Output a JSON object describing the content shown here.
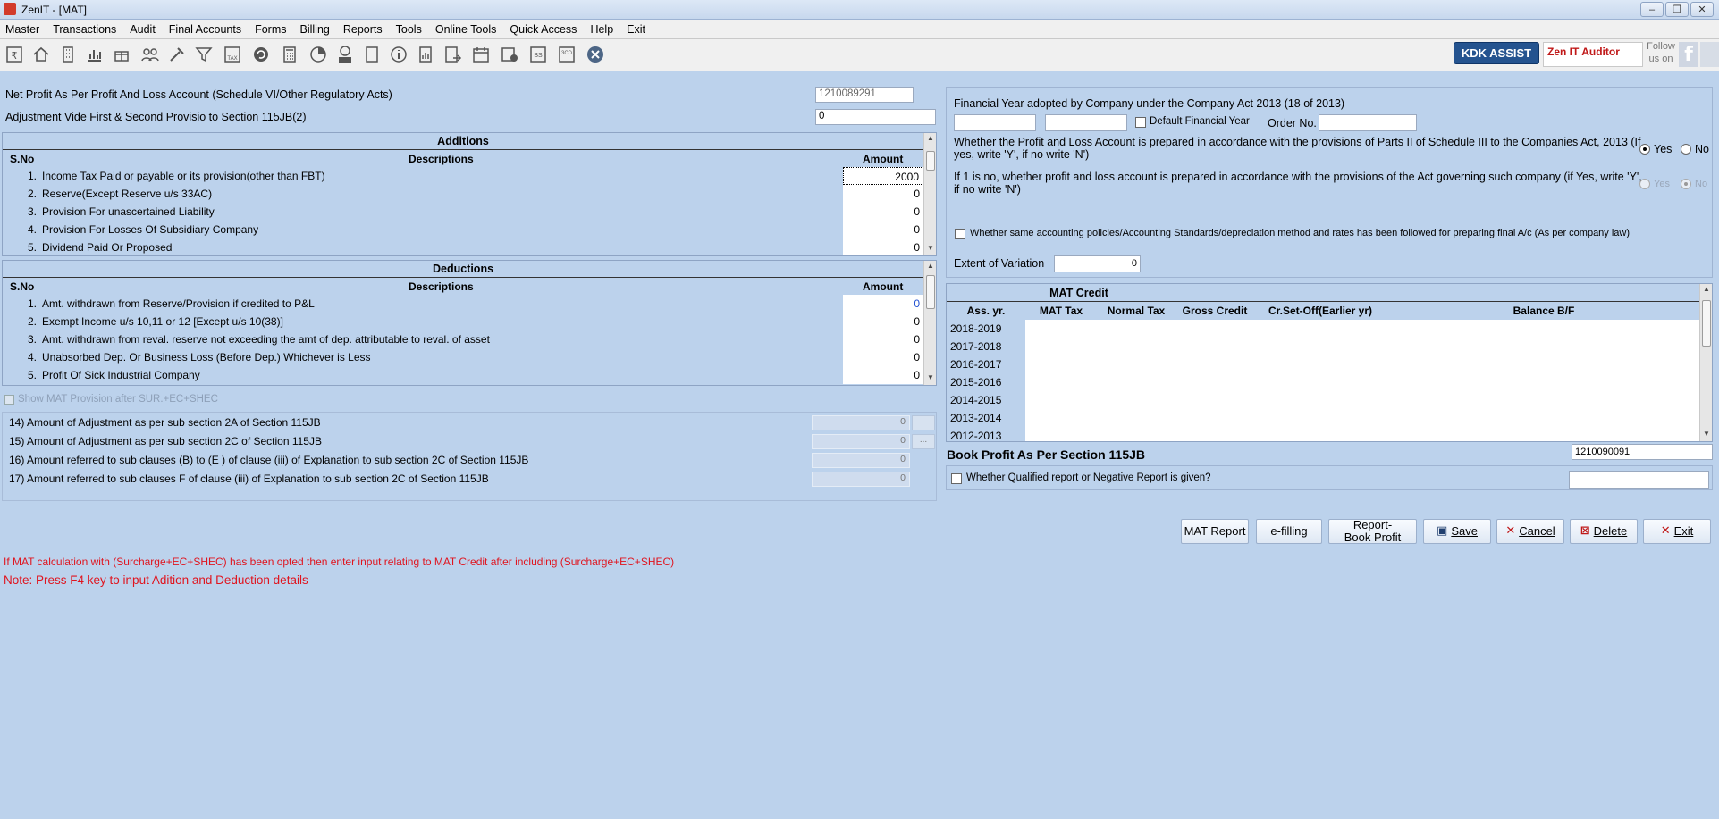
{
  "window": {
    "title": "ZenIT - [MAT]"
  },
  "menu": [
    "Master",
    "Transactions",
    "Audit",
    "Final Accounts",
    "Forms",
    "Billing",
    "Reports",
    "Tools",
    "Online Tools",
    "Quick Access",
    "Help",
    "Exit"
  ],
  "toolbar": {
    "icons": [
      "rupee-icon",
      "home-icon",
      "building-icon",
      "chart-icon",
      "gift-icon",
      "users-icon",
      "tools-icon",
      "filter-icon",
      "tax-icon",
      "refresh-icon",
      "calculator-icon",
      "pie-icon",
      "pay-icon",
      "book-icon",
      "info-icon",
      "document-icon",
      "export-icon",
      "calendar-icon",
      "settings-icon",
      "bs-icon",
      "3cd-icon",
      "close-icon"
    ],
    "kdk_assist": "KDK ASSIST",
    "zen_auditor": "Zen IT Auditor",
    "follow_us": "Follow us on"
  },
  "left": {
    "net_profit_label": "Net Profit As Per Profit And Loss Account (Schedule VI/Other Regulatory Acts)",
    "net_profit_value": "1210089291",
    "adjustment_label": "Adjustment Vide First & Second Provisio to Section 115JB(2)",
    "adjustment_value": "0",
    "additions": {
      "title": "Additions",
      "col_sno": "S.No",
      "col_desc": "Descriptions",
      "col_amount": "Amount",
      "rows": [
        {
          "sno": "1.",
          "desc": "Income Tax Paid or payable or its provision(other than FBT)",
          "amount": "2000"
        },
        {
          "sno": "2.",
          "desc": "Reserve(Except Reserve u/s 33AC)",
          "amount": "0"
        },
        {
          "sno": "3.",
          "desc": "Provision For unascertained Liability",
          "amount": "0"
        },
        {
          "sno": "4.",
          "desc": "Provision For Losses Of Subsidiary Company",
          "amount": "0"
        },
        {
          "sno": "5.",
          "desc": "Dividend Paid Or Proposed",
          "amount": "0"
        }
      ]
    },
    "deductions": {
      "title": "Deductions",
      "col_sno": "S.No",
      "col_desc": "Descriptions",
      "col_amount": "Amount",
      "rows": [
        {
          "sno": "1.",
          "desc": "Amt. withdrawn from Reserve/Provision if credited to P&L",
          "amount": "0"
        },
        {
          "sno": "2.",
          "desc": "Exempt Income u/s 10,11 or 12 [Except u/s 10(38)]",
          "amount": "0"
        },
        {
          "sno": "3.",
          "desc": "Amt. withdrawn from reval. reserve not exceeding the amt of dep. attributable to reval. of asset",
          "amount": "0"
        },
        {
          "sno": "4.",
          "desc": "Unabsorbed Dep. Or Business Loss (Before Dep.) Whichever is Less",
          "amount": "0"
        },
        {
          "sno": "5.",
          "desc": "Profit Of Sick Industrial Company",
          "amount": "0"
        }
      ]
    },
    "show_mat_provision": "Show MAT Provision after SUR.+EC+SHEC",
    "adjustments": [
      {
        "label": "14)  Amount of Adjustment as per sub section 2A of Section 115JB",
        "value": "0"
      },
      {
        "label": "15) Amount of Adjustment as per sub section 2C of Section 115JB",
        "value": "0",
        "btn": "..."
      },
      {
        "label": "16) Amount referred to sub clauses (B) to (E ) of clause (iii) of Explanation to sub section 2C of Section 115JB",
        "value": "0"
      },
      {
        "label": "17) Amount referred to sub clauses F of clause (iii) of Explanation to sub section 2C of Section 115JB",
        "value": "0"
      }
    ],
    "note1": "If MAT calculation with (Surcharge+EC+SHEC) has been opted then enter input relating to MAT Credit after including (Surcharge+EC+SHEC)",
    "note2": "Note: Press F4 key to input Adition and Deduction details"
  },
  "right": {
    "fy_label": "Financial Year adopted by Company under the Company Act 2013 (18 of 2013)",
    "default_fy": "Default Financial Year",
    "order_no": "Order No.",
    "q1": "Whether the Profit and Loss Account is prepared in accordance with the provisions of Parts II of Schedule III to the Companies Act, 2013 (If yes, write 'Y', if no write 'N')",
    "q2": "If 1 is no, whether profit and loss account is prepared in accordance with the provisions of the Act governing such company (if Yes, write 'Y', if no write 'N')",
    "yes": "Yes",
    "no": "No",
    "q3": "Whether same accounting policies/Accounting Standards/depreciation method and  rates has been followed for preparing final A/c (As per company law)",
    "extent_label": "Extent of Variation",
    "extent_value": "0",
    "mat_credit": {
      "title": "MAT Credit",
      "columns": [
        "Ass. yr.",
        "MAT Tax",
        "Normal Tax",
        "Gross Credit",
        "Cr.Set-Off(Earlier yr)",
        "Balance B/F"
      ],
      "years": [
        "2018-2019",
        "2017-2018",
        "2016-2017",
        "2015-2016",
        "2014-2015",
        "2013-2014",
        "2012-2013"
      ]
    },
    "book_profit_label": "Book Profit As Per Section 115JB",
    "book_profit_value": "1210090091",
    "qualified_report": "Whether Qualified report or Negative Report is given?"
  },
  "buttons": {
    "mat_report": "MAT Report",
    "efilling": "e-filling",
    "report_book_profit": "Report-Book Profit",
    "save": "Save",
    "cancel": "Cancel",
    "delete": "Delete",
    "exit": "Exit"
  },
  "colors": {
    "background": "#bcd2ec",
    "warning": "#e0141e",
    "accent": "#24538f"
  }
}
